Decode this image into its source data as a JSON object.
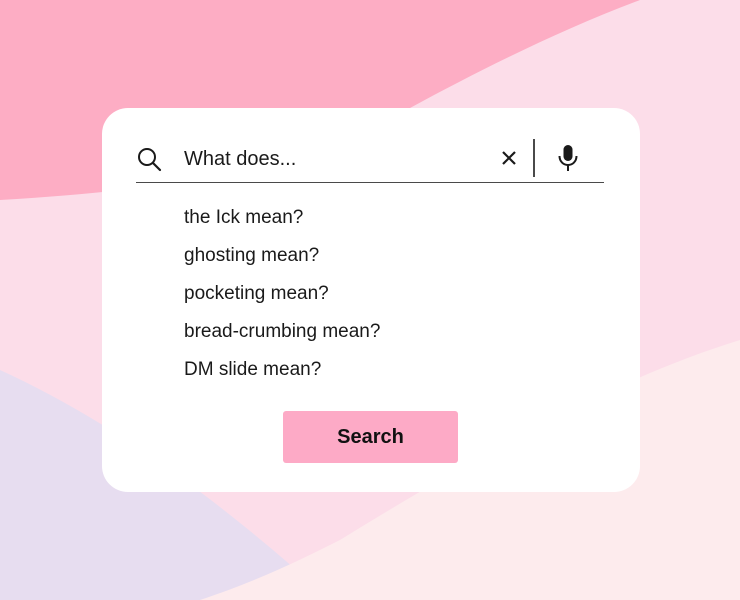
{
  "theme": {
    "accent": "#fdaac6",
    "background_pink": "#fcdde9",
    "background_peach": "#fdebed",
    "background_lavender": "#e7ddf0",
    "background_deep_pink": "#fdadc4"
  },
  "search": {
    "placeholder": "What does...",
    "icons": [
      "search-icon",
      "close-icon",
      "microphone-icon"
    ]
  },
  "suggestions": [
    "the Ick mean?",
    "ghosting mean?",
    "pocketing mean?",
    "bread-crumbing mean?",
    "DM slide mean?"
  ],
  "button": {
    "label": "Search"
  }
}
